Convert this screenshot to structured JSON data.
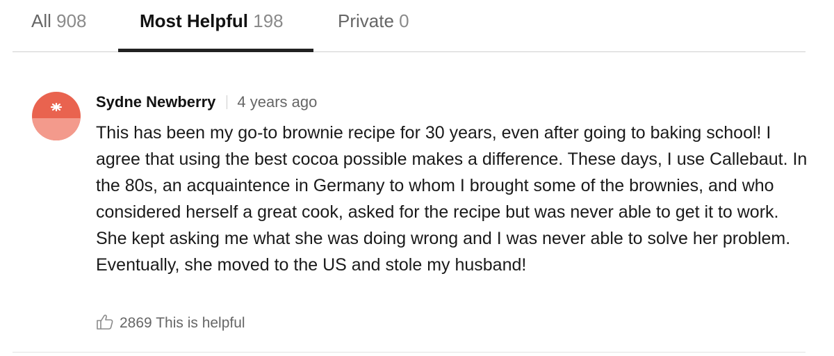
{
  "tabs": [
    {
      "label": "All",
      "count": "908"
    },
    {
      "label": "Most Helpful",
      "count": "198",
      "active": true
    },
    {
      "label": "Private",
      "count": "0"
    }
  ],
  "comment": {
    "author": "Sydne Newberry",
    "time": "4 years ago",
    "avatar_icon": "tomato-icon",
    "body": "This has been my go-to brownie recipe for 30 years, even after going to baking school! I agree that using the best cocoa possible makes a difference. These days, I use Callebaut. In the 80s, an acquaintence in Germany to whom I brought some of the brownies, and who considered herself a great cook, asked for the recipe but was never able to get it to work. She kept asking me what she was doing wrong and I was never able to solve her problem. Eventually, she moved to the US and stole my husband!",
    "helpful_count": "2869",
    "helpful_label": "This is helpful",
    "helpful_icon": "thumbs-up-icon"
  },
  "colors": {
    "active_tab_indicator": "#222222",
    "avatar_tomato": "#e9634f",
    "avatar_tomato_light": "#f39a8c"
  }
}
